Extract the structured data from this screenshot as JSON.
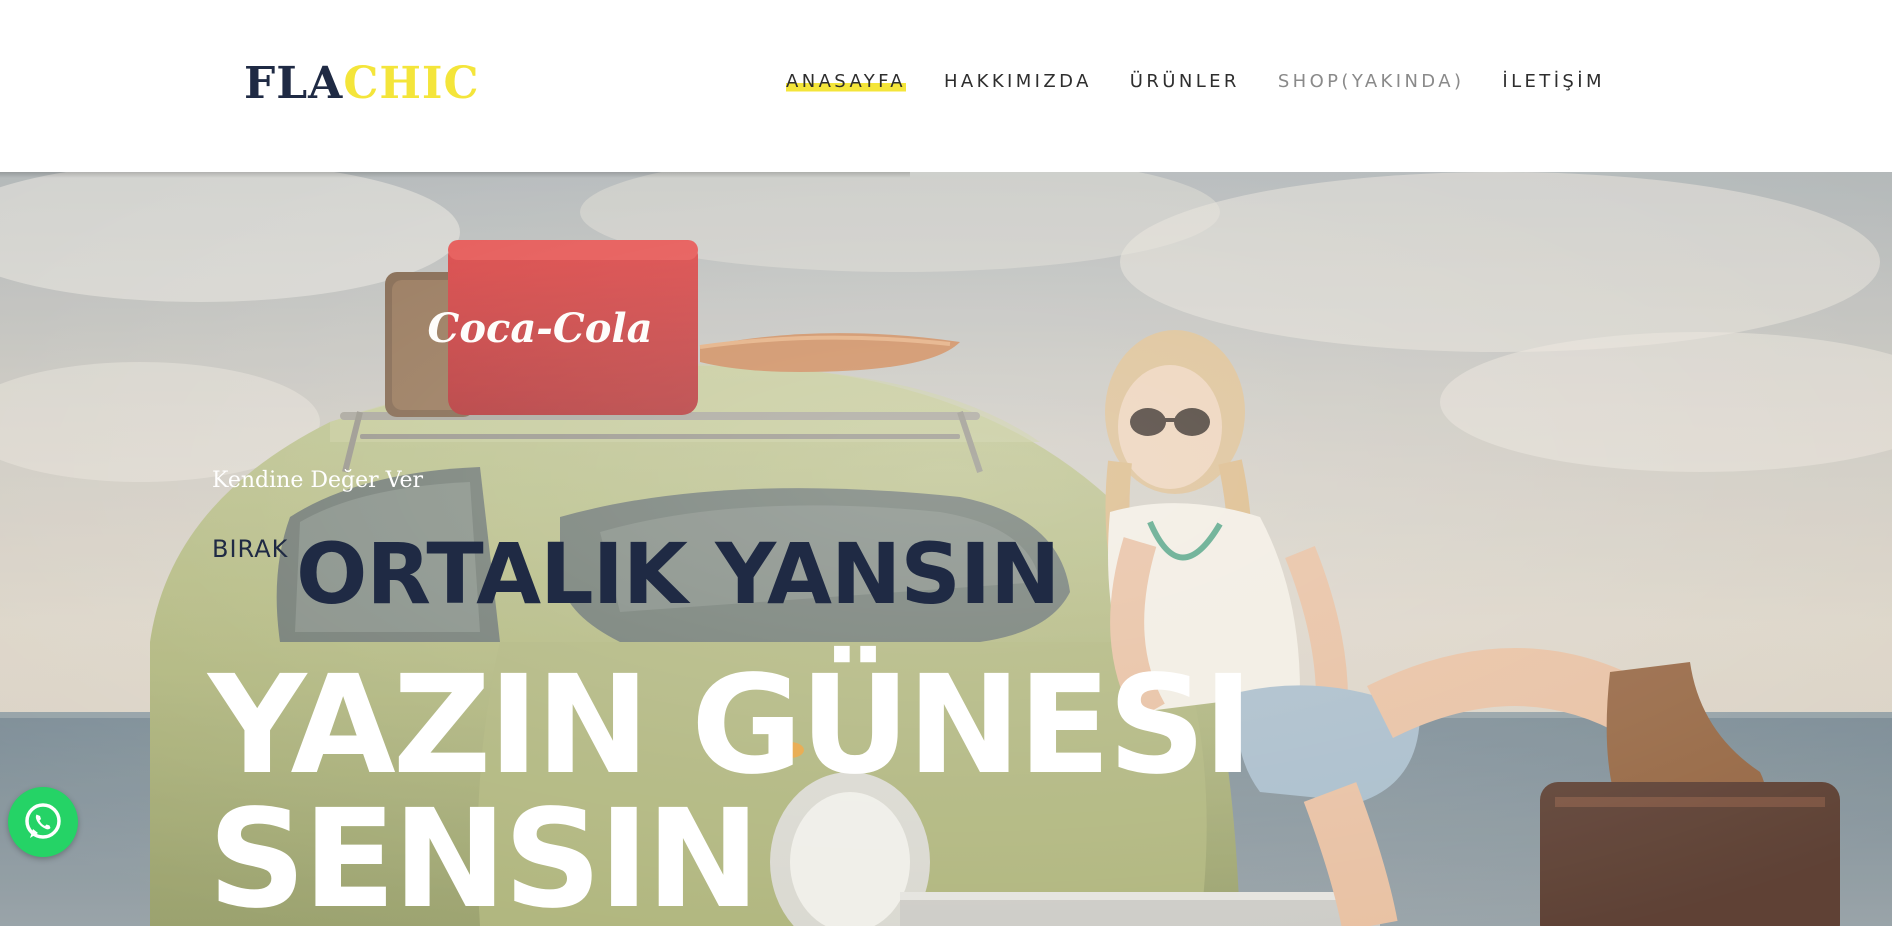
{
  "logo": {
    "part1": "FLA",
    "part2": "CHIC"
  },
  "nav": {
    "items": [
      {
        "label": "ANASAYFA",
        "state": "active"
      },
      {
        "label": "HAKKIMIZDA",
        "state": "normal"
      },
      {
        "label": "ÜRÜNLER",
        "state": "normal"
      },
      {
        "label": "SHOP(YAKINDA)",
        "state": "muted"
      },
      {
        "label": "İLETİŞİM",
        "state": "normal"
      }
    ]
  },
  "hero": {
    "tagline": "Kendine Değer Ver",
    "prefix": "BIRAK",
    "headline_dark": "ORTALIK YANSIN",
    "headline_line1": "YAZIN GÜNESI",
    "headline_line2": "SENSIN",
    "background_image": "photo of a woman sitting on a green vintage car with a red Coca-Cola cooler on the roof rack, beach and sky behind"
  },
  "colors": {
    "brand_dark": "#1f2a44",
    "brand_yellow": "#f4e53a",
    "whatsapp_green": "#25d366"
  },
  "icons": {
    "whatsapp": "whatsapp-icon"
  }
}
